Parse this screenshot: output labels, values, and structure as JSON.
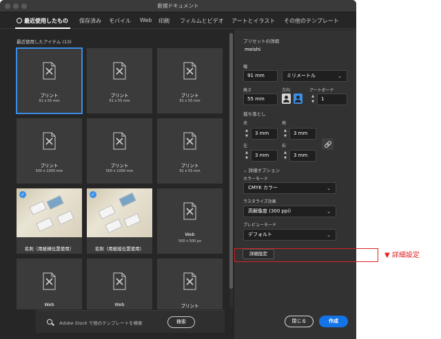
{
  "window": {
    "title": "新規ドキュメント"
  },
  "tabs": [
    {
      "label": "最近使用したもの",
      "active": true
    },
    {
      "label": "保存済み"
    },
    {
      "label": "モバイル"
    },
    {
      "label": "Web"
    },
    {
      "label": "印刷"
    },
    {
      "label": "フィルムとビデオ"
    },
    {
      "label": "アートとイラスト"
    },
    {
      "label": "その他のテンプレート"
    }
  ],
  "recent": {
    "heading": "最近使用したアイテム",
    "count": "(13)",
    "items": [
      {
        "name": "プリント",
        "size": "91 x 55 mm",
        "selected": true
      },
      {
        "name": "プリント",
        "size": "91 x 55 mm"
      },
      {
        "name": "プリント",
        "size": "91 x 55 mm"
      },
      {
        "name": "プリント",
        "size": "500 x 1000 mm"
      },
      {
        "name": "プリント",
        "size": "500 x 1000 mm"
      },
      {
        "name": "プリント",
        "size": "91 x 55 mm"
      },
      {
        "name": "名刺（用紙横位置使用）",
        "size": ""
      },
      {
        "name": "名刺（用紙縦位置使用）",
        "size": ""
      },
      {
        "name": "Web",
        "size": "500 x 500 px"
      },
      {
        "name": "Web",
        "size": ""
      },
      {
        "name": "Web",
        "size": ""
      },
      {
        "name": "プリント",
        "size": ""
      }
    ]
  },
  "search": {
    "placeholder_brand": "Adobe Stock",
    "placeholder_rest": " で他のテンプレートを検索",
    "button": "検索"
  },
  "preset": {
    "heading": "プリセットの詳細",
    "name": "meishi",
    "width_label": "幅",
    "width_value": "91 mm",
    "unit_value": "ミリメートル",
    "height_label": "高さ",
    "height_value": "55 mm",
    "orientation_label": "方向",
    "artboard_label": "アートボード",
    "artboard_value": "1",
    "bleed_label": "裁ち落とし",
    "top_label": "天",
    "top_value": "3 mm",
    "bottom_label": "地",
    "bottom_value": "3 mm",
    "left_label": "左",
    "left_value": "3 mm",
    "right_label": "右",
    "right_value": "3 mm",
    "advanced_toggle": "詳細オプション",
    "color_mode_label": "カラーモード",
    "color_mode_value": "CMYK カラー",
    "raster_label": "ラスタライズ効果",
    "raster_value": "高解像度 (300 ppi)",
    "preview_label": "プレビューモード",
    "preview_value": "デフォルト",
    "advanced_button": "詳細設定"
  },
  "footer": {
    "close": "閉じる",
    "create": "作成"
  },
  "annotation": {
    "text": "▼ 詳細設定",
    "color": "#e02020"
  },
  "colors": {
    "accent": "#1473e6",
    "selection": "#3a8ee6",
    "panel": "#323232",
    "background": "#262626"
  }
}
